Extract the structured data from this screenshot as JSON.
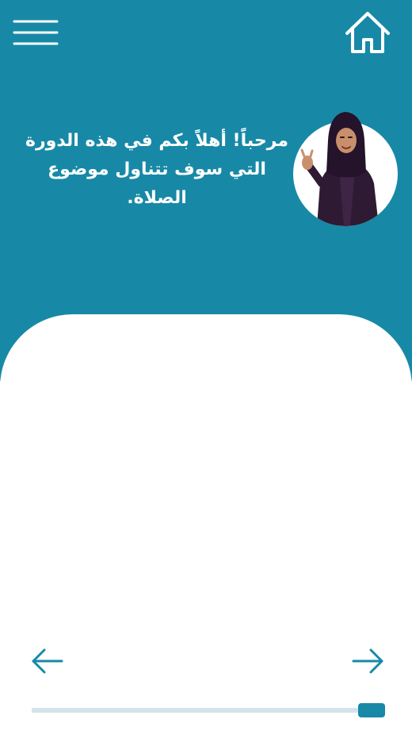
{
  "header": {
    "menu_icon": "hamburger-menu-icon",
    "home_icon": "home-icon"
  },
  "intro": {
    "text": "مرحباً! أهلاً بكم في هذه الدورة التي سوف تتناول موضوع الصلاة.",
    "avatar": "presenter-avatar"
  },
  "navigation": {
    "prev_icon": "arrow-left-icon",
    "next_icon": "arrow-right-icon"
  },
  "progress": {
    "value": 1.0
  },
  "colors": {
    "primary": "#1789a6",
    "card": "#ffffff",
    "track": "#d3e3ea",
    "handle": "#1789a6",
    "icon_white": "#ffffff"
  }
}
